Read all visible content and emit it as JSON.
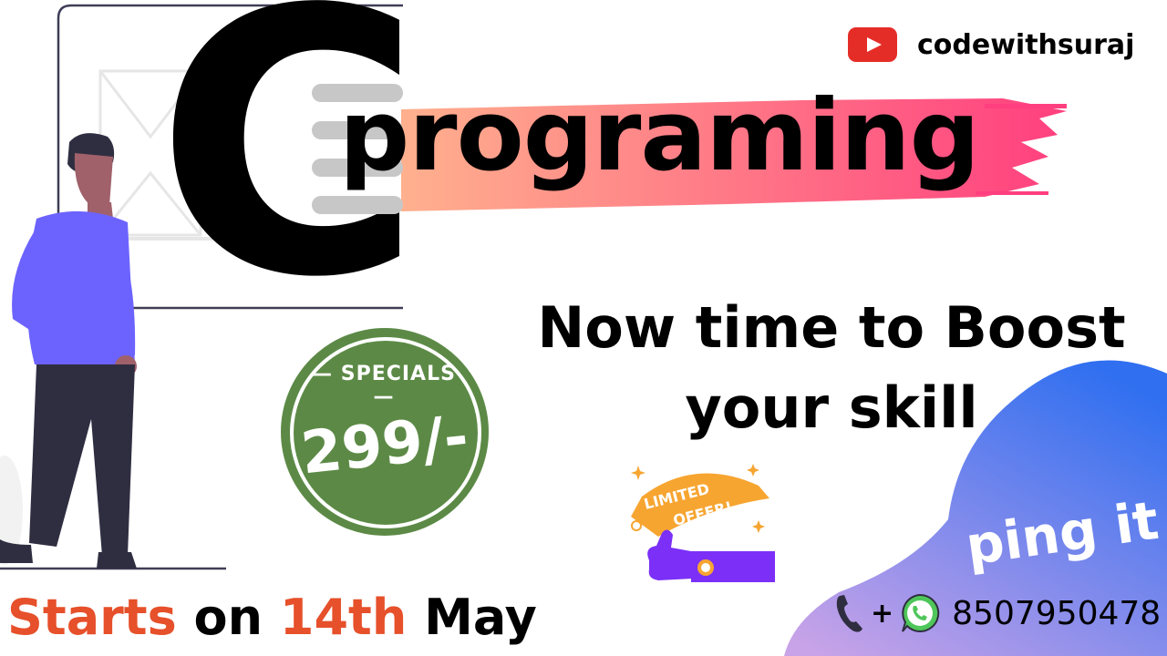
{
  "channel": {
    "name": "codewithsuraj",
    "icon": "youtube-icon"
  },
  "title": {
    "letter": "C",
    "word": "programing"
  },
  "tagline": {
    "line1": "Now time to Boost",
    "line2": "your skill"
  },
  "badge": {
    "label": "SPECIALS",
    "price": "299/-"
  },
  "offer": {
    "line1": "LIMITED",
    "line2": "OFFER!"
  },
  "cta": {
    "text": "ping it",
    "plus": "+",
    "phone": "8507950478"
  },
  "start": {
    "word1": "Starts",
    "word2": "on",
    "date": "14th",
    "month": "May"
  },
  "colors": {
    "accent_orange": "#e6502a",
    "badge_green": "#5c8a46",
    "blob_blue": "#2f6ff0",
    "stroke_pink": "#ff3f7f",
    "stroke_peach": "#ffb08e",
    "person_shirt": "#6c63ff",
    "person_pants": "#2f2e41"
  }
}
